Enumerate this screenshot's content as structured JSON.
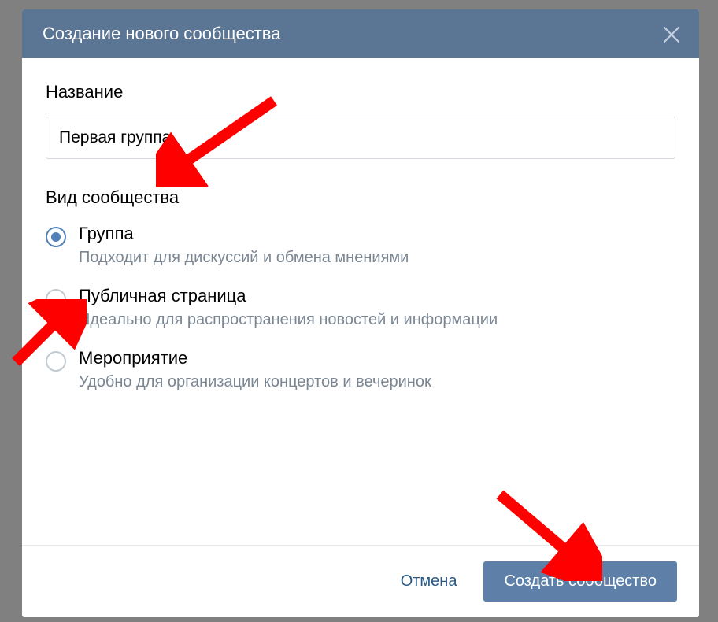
{
  "dialog": {
    "title": "Создание нового сообщества",
    "name_label": "Название",
    "name_value": "Первая группа",
    "type_label": "Вид сообщества",
    "options": [
      {
        "title": "Группа",
        "desc": "Подходит для дискуссий и обмена мнениями",
        "selected": true
      },
      {
        "title": "Публичная страница",
        "desc": "Идеально для распространения новостей и информации",
        "selected": false
      },
      {
        "title": "Мероприятие",
        "desc": "Удобно для организации концертов и вечеринок",
        "selected": false
      }
    ],
    "cancel_label": "Отмена",
    "create_label": "Создать сообщество"
  }
}
